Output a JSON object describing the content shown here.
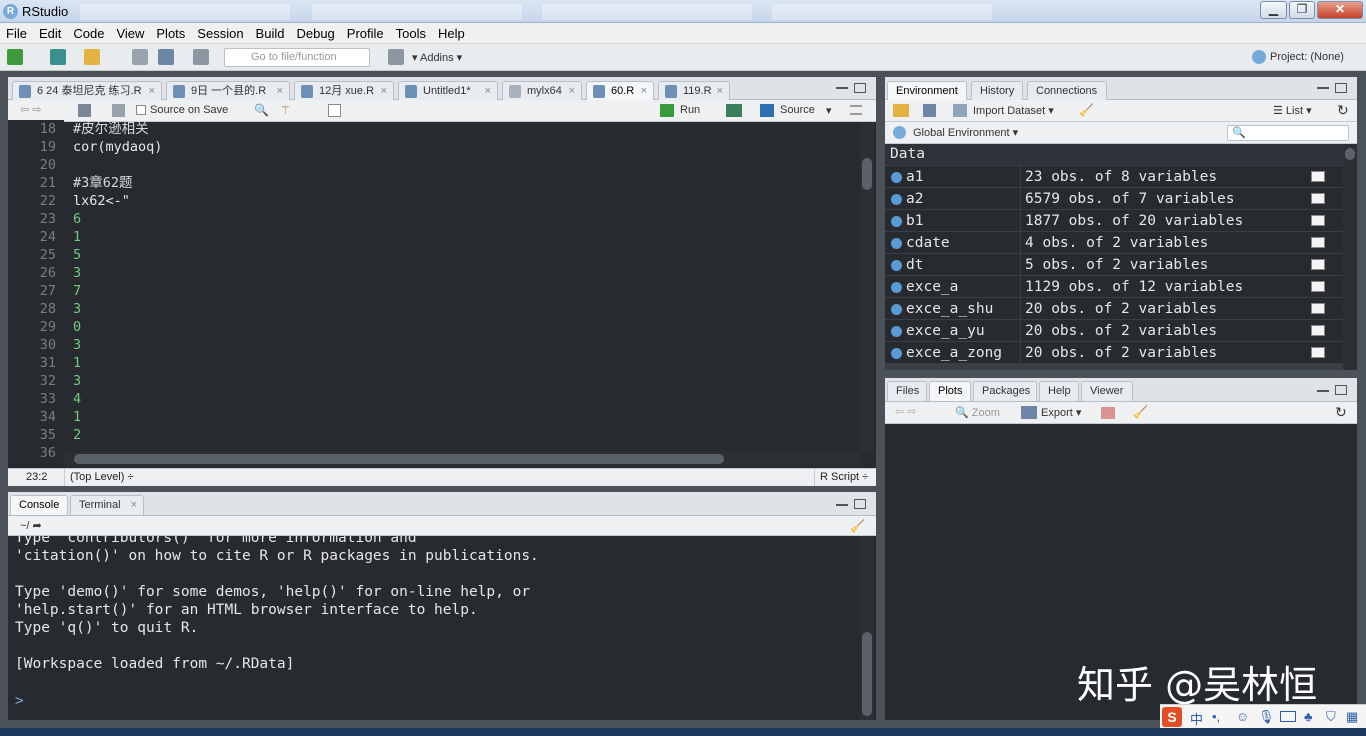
{
  "window": {
    "title": "RStudio",
    "min": "▁",
    "max": "❐",
    "close": "✕"
  },
  "menu": [
    "File",
    "Edit",
    "Code",
    "View",
    "Plots",
    "Session",
    "Build",
    "Debug",
    "Profile",
    "Tools",
    "Help"
  ],
  "toolbar": {
    "goto_placeholder": "Go to file/function",
    "addins": "Addins",
    "project": "Project: (None)"
  },
  "editor": {
    "tabs": [
      {
        "label": "6 24 泰坦尼克 练习.R"
      },
      {
        "label": "9日 一个县的.R"
      },
      {
        "label": "12月 xue.R"
      },
      {
        "label": "Untitled1*"
      },
      {
        "label": "mylx64"
      },
      {
        "label": "60.R"
      },
      {
        "label": "119.R"
      }
    ],
    "source_on_save": "Source on Save",
    "run": "Run",
    "source": "Source",
    "lines": [
      {
        "n": "18",
        "t": "#皮尔逊相关",
        "c": "comment"
      },
      {
        "n": "19",
        "t": "cor(mydaoq)",
        "c": "plain"
      },
      {
        "n": "20",
        "t": "",
        "c": "plain"
      },
      {
        "n": "21",
        "t": "#3章62题",
        "c": "comment"
      },
      {
        "n": "22",
        "t": "lx62<-\"",
        "c": "plain"
      },
      {
        "n": "23",
        "t": "6",
        "c": "num"
      },
      {
        "n": "24",
        "t": "1",
        "c": "num"
      },
      {
        "n": "25",
        "t": "5",
        "c": "num"
      },
      {
        "n": "26",
        "t": "3",
        "c": "num"
      },
      {
        "n": "27",
        "t": "7",
        "c": "num"
      },
      {
        "n": "28",
        "t": "3",
        "c": "num"
      },
      {
        "n": "29",
        "t": "0",
        "c": "num"
      },
      {
        "n": "30",
        "t": "3",
        "c": "num"
      },
      {
        "n": "31",
        "t": "1",
        "c": "num"
      },
      {
        "n": "32",
        "t": "3",
        "c": "num"
      },
      {
        "n": "33",
        "t": "4",
        "c": "num"
      },
      {
        "n": "34",
        "t": "1",
        "c": "num"
      },
      {
        "n": "35",
        "t": "2",
        "c": "num"
      },
      {
        "n": "36",
        "t": "",
        "c": "num"
      }
    ],
    "status": {
      "pos": "23:2",
      "scope": "(Top Level) ÷",
      "type": "R Script ÷"
    }
  },
  "console": {
    "tabs": [
      {
        "label": "Console"
      },
      {
        "label": "Terminal"
      }
    ],
    "path": "~/",
    "lines": [
      "Type 'contributors()' for more information and",
      "'citation()' on how to cite R or R packages in publications.",
      "",
      "Type 'demo()' for some demos, 'help()' for on-line help, or",
      "'help.start()' for an HTML browser interface to help.",
      "Type 'q()' to quit R.",
      "",
      "[Workspace loaded from ~/.RData]",
      "",
      ""
    ],
    "prompt": ">"
  },
  "env": {
    "tabs": [
      {
        "label": "Environment"
      },
      {
        "label": "History"
      },
      {
        "label": "Connections"
      }
    ],
    "import": "Import Dataset",
    "list": "List",
    "scope": "Global Environment",
    "section": "Data",
    "rows": [
      {
        "name": "a1",
        "value": "23 obs. of 8 variables"
      },
      {
        "name": "a2",
        "value": "6579 obs. of 7 variables"
      },
      {
        "name": "b1",
        "value": "1877 obs. of 20 variables"
      },
      {
        "name": "cdate",
        "value": "4 obs. of 2 variables"
      },
      {
        "name": "dt",
        "value": "5 obs. of 2 variables"
      },
      {
        "name": "exce_a",
        "value": "1129 obs. of 12 variables"
      },
      {
        "name": "exce_a_shu",
        "value": "20 obs. of 2 variables"
      },
      {
        "name": "exce_a_yu",
        "value": "20 obs. of 2 variables"
      },
      {
        "name": "exce_a_zong",
        "value": "20 obs. of 2 variables"
      }
    ]
  },
  "files": {
    "tabs": [
      {
        "label": "Files"
      },
      {
        "label": "Plots"
      },
      {
        "label": "Packages"
      },
      {
        "label": "Help"
      },
      {
        "label": "Viewer"
      }
    ],
    "zoom": "Zoom",
    "export": "Export"
  },
  "watermark": "知乎 @吴林恒",
  "ime": "中"
}
